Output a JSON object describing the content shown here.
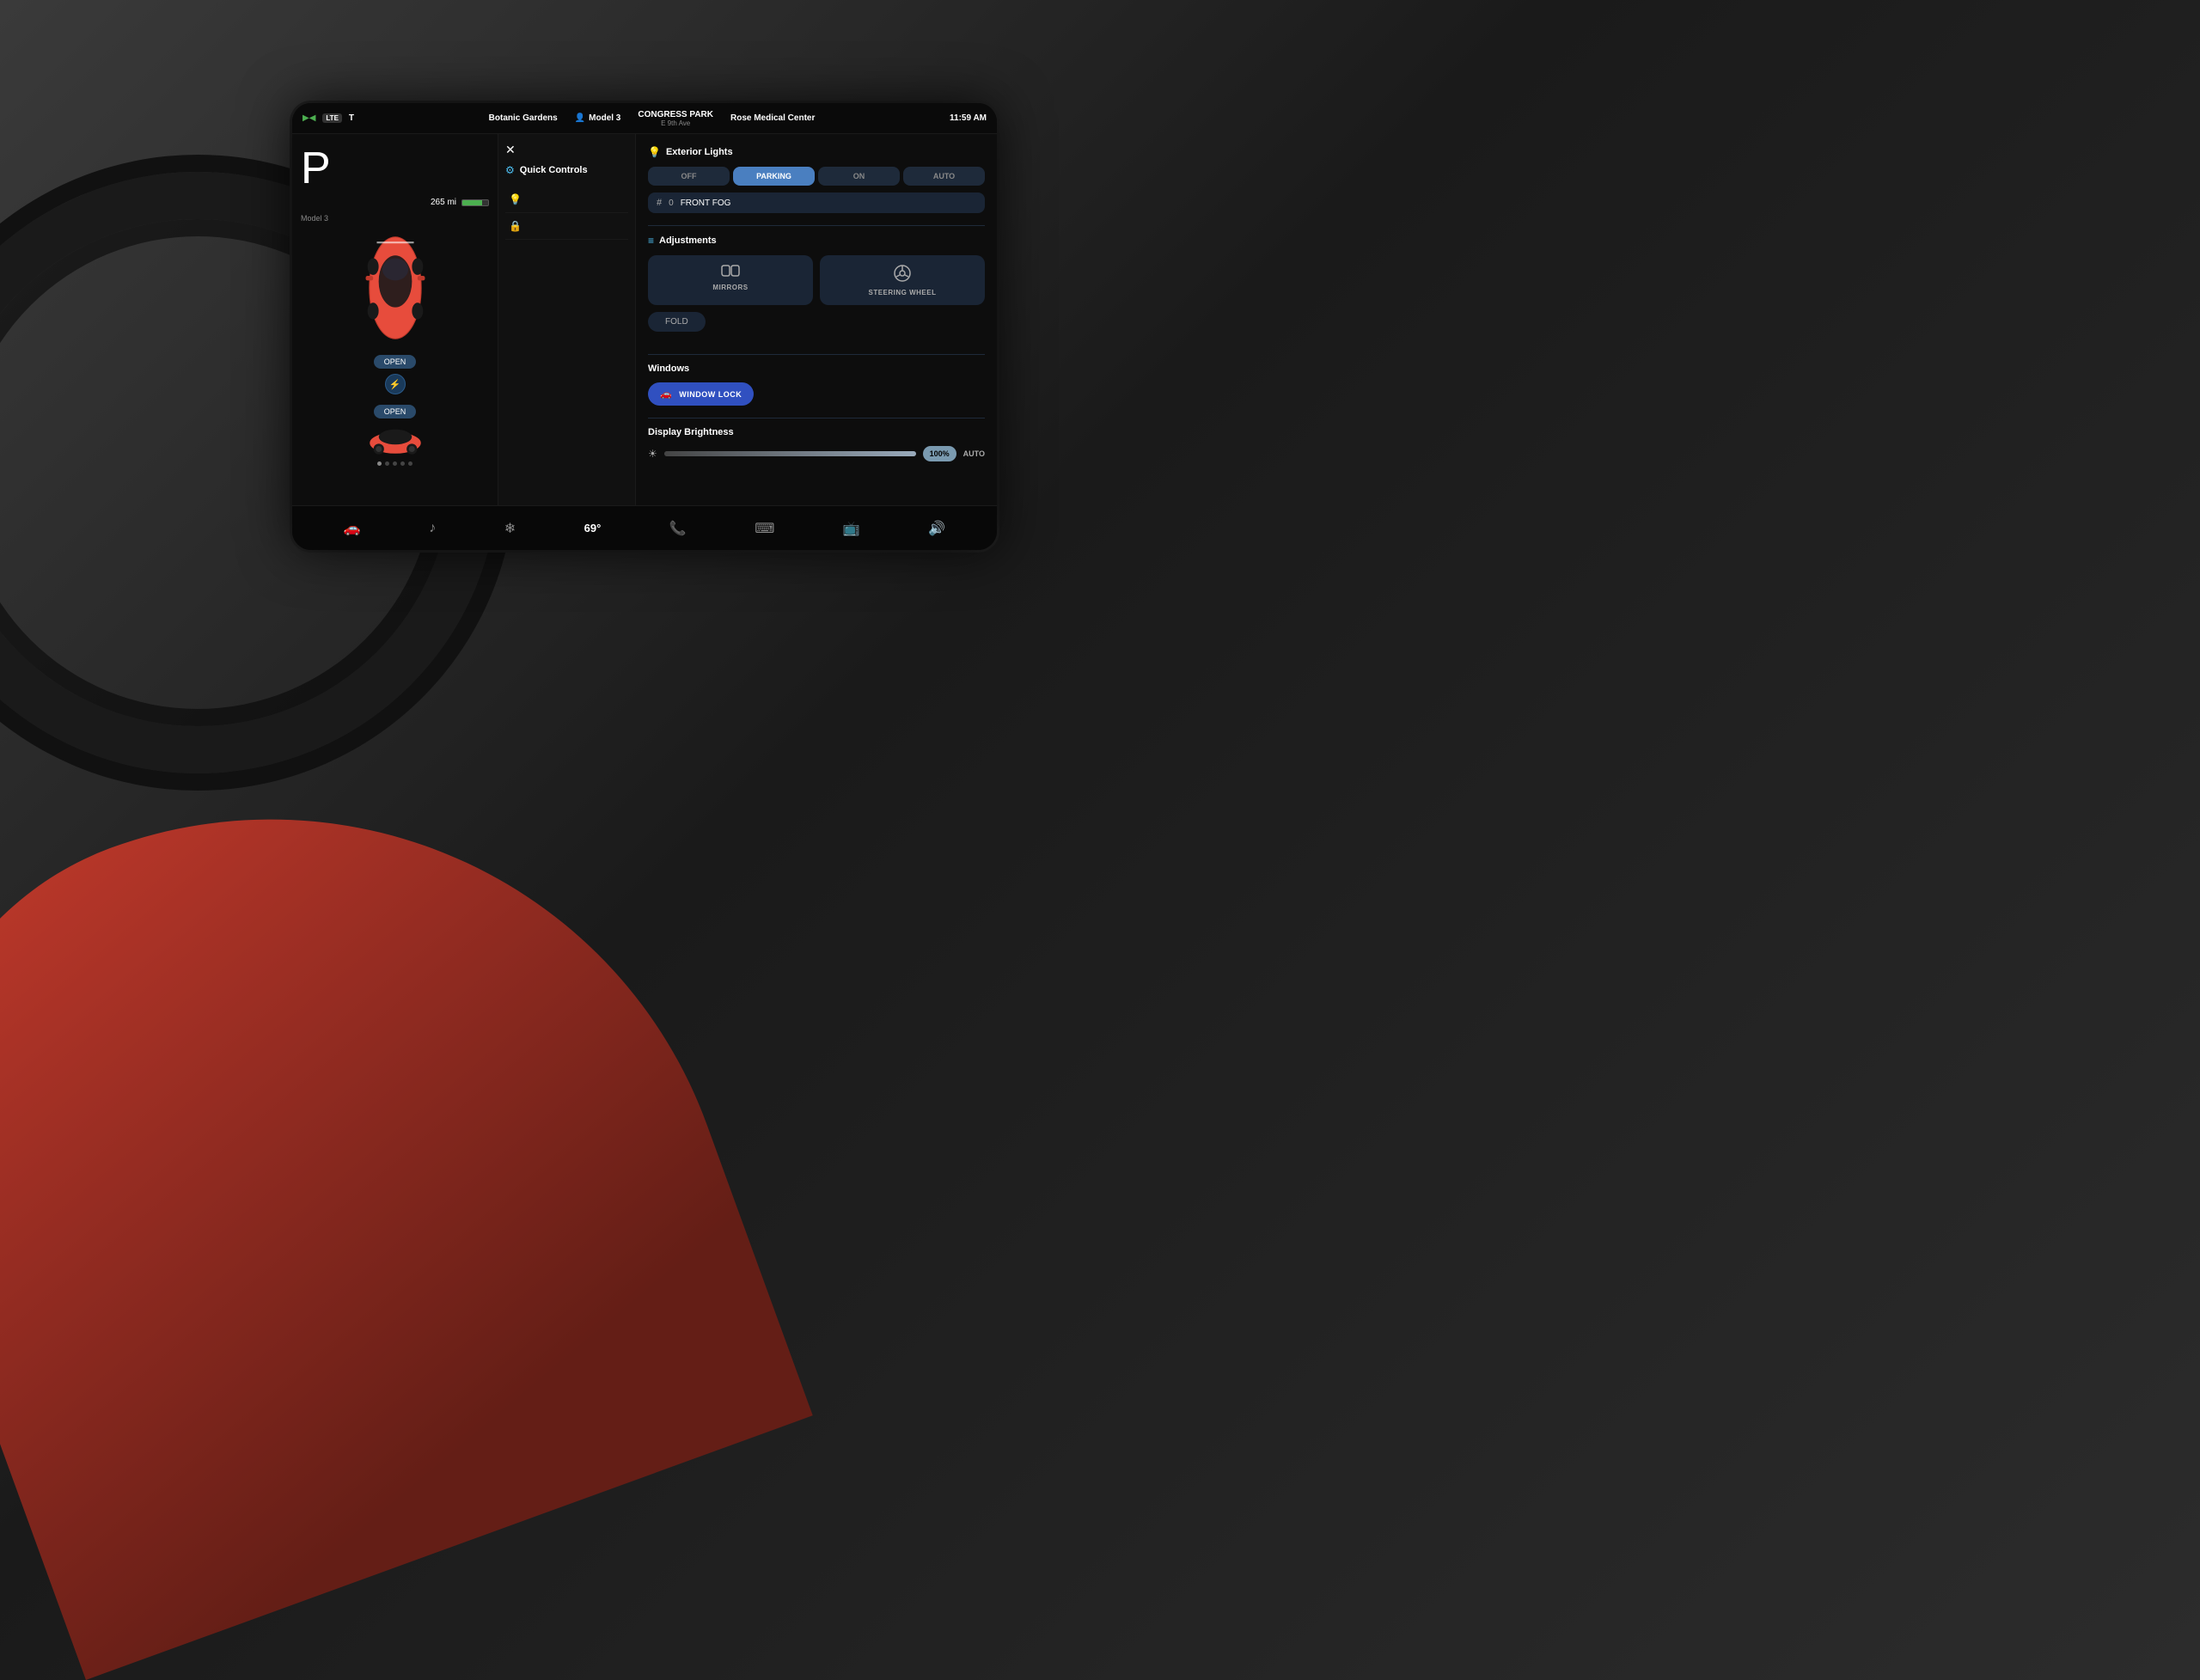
{
  "background": {
    "color": "#2a2a2a"
  },
  "screen": {
    "statusBar": {
      "leftIcons": [
        "3G-icon",
        "wifi-icon"
      ],
      "lte": "LTE",
      "signal": "T",
      "location1": "Botanic Gardens",
      "location2": "CONGRESS PARK",
      "carModel": "Model 3",
      "nearbyLocation": "Rose Medical Center",
      "nearbyStreet": "E 9th Ave",
      "time": "11:59 AM"
    },
    "leftPanel": {
      "parkIndicator": "P",
      "range": "265 mi",
      "carLabel": "Model 3",
      "openBtn1": "OPEN",
      "chargeIcon": "⚡",
      "openBtn2": "OPEN"
    },
    "middlePanel": {
      "closeBtn": "✕",
      "title": "Quick Controls",
      "titleIcon": "⚙",
      "items": [
        {
          "icon": "💡",
          "label": ""
        },
        {
          "icon": "🔒",
          "label": ""
        }
      ]
    },
    "rightPanel": {
      "exteriorLights": {
        "sectionLabel": "Exterior Lights",
        "sectionIcon": "💡",
        "buttons": [
          "OFF",
          "PARKING",
          "ON",
          "AUTO"
        ],
        "activeButton": "PARKING",
        "fogRow": {
          "icon": "#0",
          "label": "FRONT FOG"
        }
      },
      "adjustments": {
        "sectionLabel": "Adjustments",
        "sectionIcon": "≡",
        "mirrors": {
          "label": "MIRRORS",
          "icon": "🪞"
        },
        "steeringWheel": {
          "label": "STEERING WHEEL",
          "icon": "🔵"
        },
        "foldBtn": "FOLD"
      },
      "windows": {
        "sectionLabel": "Windows",
        "windowLockBtn": "WINDOW LOCK",
        "windowLockIcon": "🚗"
      },
      "displayBrightness": {
        "sectionLabel": "Display Brightness",
        "sunIcon": "☀",
        "value": "100%",
        "autoLabel": "AUTO"
      }
    },
    "taskbar": {
      "items": [
        {
          "icon": "🚗",
          "name": "car-icon"
        },
        {
          "icon": "♪",
          "name": "music-icon"
        },
        {
          "icon": "❄",
          "name": "climate-icon"
        },
        {
          "icon": "69°",
          "name": "temp-display"
        },
        {
          "icon": "📞",
          "name": "phone-icon"
        },
        {
          "icon": "⌨",
          "name": "nav-icon"
        },
        {
          "icon": "📺",
          "name": "display-icon"
        },
        {
          "icon": "🔊",
          "name": "volume-icon"
        }
      ]
    }
  }
}
